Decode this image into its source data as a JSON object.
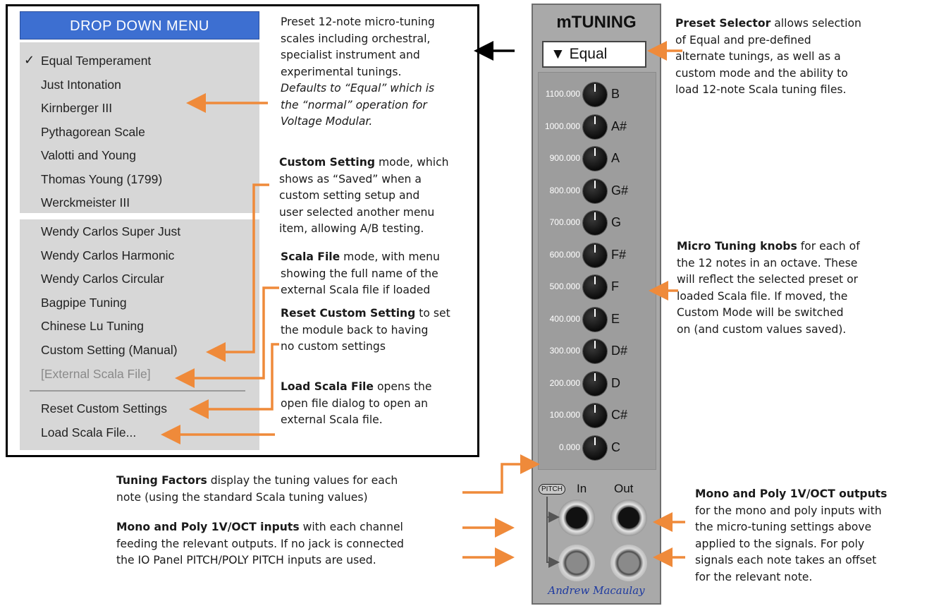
{
  "menu": {
    "title": "DROP DOWN MENU",
    "checkmark": "✓",
    "items_group1": [
      "Equal Temperament",
      "Just Intonation",
      "Kirnberger III",
      "Pythagorean Scale",
      "Valotti and Young",
      "Thomas Young (1799)",
      "Werckmeister III"
    ],
    "items_group2": [
      "Wendy Carlos Super Just",
      "Wendy Carlos Harmonic",
      "Wendy Carlos Circular",
      "Bagpipe Tuning",
      "Chinese Lu Tuning",
      "Custom Setting (Manual)"
    ],
    "disabled_item": "[External Scala File]",
    "items_group3": [
      "Reset Custom Settings",
      "Load Scala File..."
    ]
  },
  "notes": {
    "preset": {
      "l1": "Preset 12-note micro-tuning",
      "l2": "scales including orchestral,",
      "l3": "specialist instrument and",
      "l4": "experimental tunings.",
      "l5": "Defaults to “Equal” which is",
      "l6": "the “normal” operation for",
      "l7": "Voltage Modular."
    },
    "custom": {
      "bold": "Custom Setting",
      "l1": " mode, which",
      "l2": "shows as “Saved” when a",
      "l3": "custom setting setup and",
      "l4": "user selected another menu",
      "l5": "item, allowing A/B testing."
    },
    "scala": {
      "bold": "Scala File",
      "l1": " mode, with menu",
      "l2": "showing the full name of the",
      "l3": "external Scala file if loaded"
    },
    "reset": {
      "bold": "Reset Custom Setting",
      "l1": " to set",
      "l2": "the module back to having",
      "l3": "no custom settings"
    },
    "load": {
      "bold": "Load Scala File",
      "l1": " opens the",
      "l2": "open file dialog to open an",
      "l3": "external Scala file."
    },
    "selector": {
      "bold": "Preset Selector",
      "l1": " allows selection",
      "l2": "of Equal and pre-defined",
      "l3": "alternate tunings, as well as a",
      "l4": "custom mode and the ability to",
      "l5": "load 12-note Scala tuning files."
    },
    "knobs": {
      "bold": "Micro Tuning knobs",
      "l1": " for each of",
      "l2": "the 12 notes in an octave. These",
      "l3": "will reflect the selected preset or",
      "l4": "loaded Scala file. If moved, the",
      "l5": "Custom Mode will be switched",
      "l6": "on (and custom values saved)."
    },
    "factors": {
      "bold": "Tuning Factors",
      "l1": " display the tuning values for each",
      "l2": "note (using the standard Scala tuning values)"
    },
    "inputs": {
      "bold": "Mono and Poly 1V/OCT inputs",
      "l1": " with each channel",
      "l2": "feeding the relevant outputs. If no jack is connected",
      "l3": "the IO Panel PITCH/POLY PITCH inputs are used."
    },
    "outputs": {
      "bold": "Mono and Poly 1V/OCT outputs",
      "l1": "for the mono and poly inputs with",
      "l2": "the micro-tuning settings above",
      "l3": "applied to the signals. For poly",
      "l4": "signals each note takes an offset",
      "l5": "for the relevant note."
    }
  },
  "module": {
    "title": "mTUNING",
    "preset_value": "▼ Equal",
    "knobs": [
      {
        "value": "1100.000",
        "note": "B"
      },
      {
        "value": "1000.000",
        "note": "A#"
      },
      {
        "value": "900.000",
        "note": "A"
      },
      {
        "value": "800.000",
        "note": "G#"
      },
      {
        "value": "700.000",
        "note": "G"
      },
      {
        "value": "600.000",
        "note": "F#"
      },
      {
        "value": "500.000",
        "note": "F"
      },
      {
        "value": "400.000",
        "note": "E"
      },
      {
        "value": "300.000",
        "note": "D#"
      },
      {
        "value": "200.000",
        "note": "D"
      },
      {
        "value": "100.000",
        "note": "C#"
      },
      {
        "value": "0.000",
        "note": "C"
      }
    ],
    "pitch_tag": "PITCH",
    "in_label": "In",
    "out_label": "Out",
    "signature": "Andrew Macaulay"
  },
  "colors": {
    "accent_arrow": "#ef8a3a",
    "menu_header": "#3d6fd1",
    "panel": "#a9a9a9"
  }
}
